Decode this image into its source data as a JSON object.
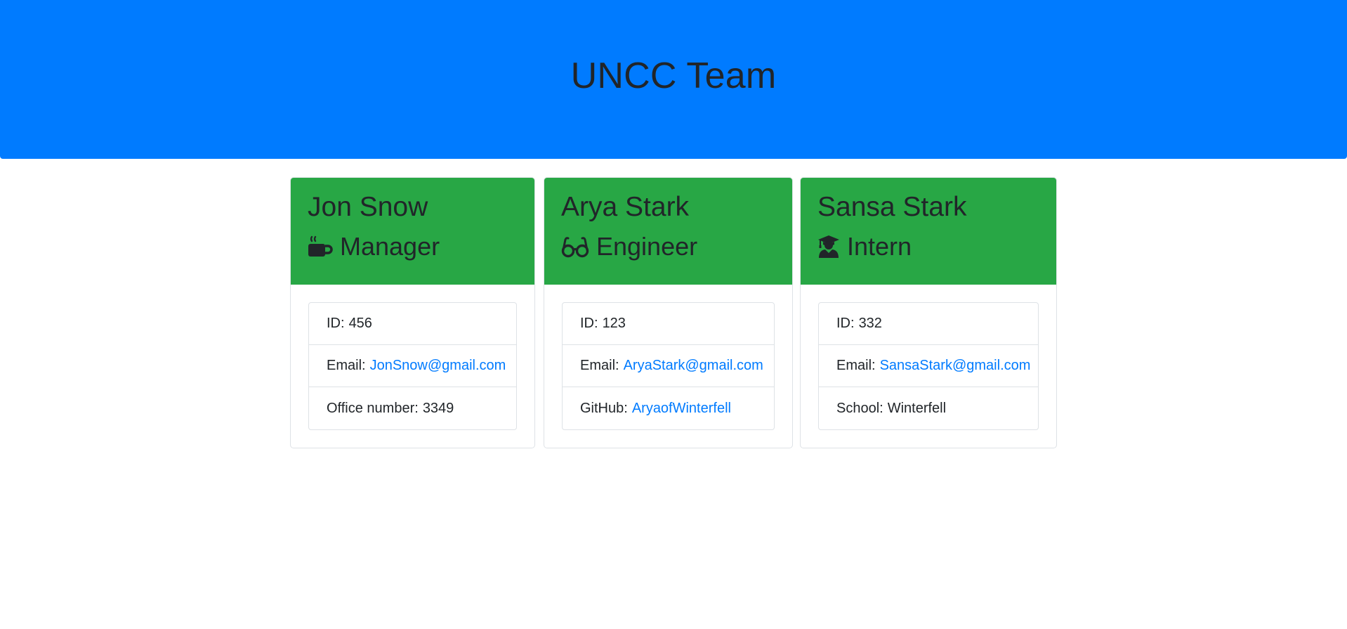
{
  "header": {
    "title": "UNCC Team"
  },
  "colors": {
    "header_bg": "#007bff",
    "card_header_bg": "#28a745",
    "link": "#007bff",
    "text": "#212529"
  },
  "cards": [
    {
      "name": "Jon Snow",
      "role": "Manager",
      "role_icon": "mug-hot-icon",
      "id_label": "ID:",
      "id": "456",
      "email_label": "Email:",
      "email": "JonSnow@gmail.com",
      "extra_label": "Office number:",
      "extra_value": "3349"
    },
    {
      "name": "Arya Stark",
      "role": "Engineer",
      "role_icon": "glasses-icon",
      "id_label": "ID:",
      "id": "123",
      "email_label": "Email:",
      "email": "AryaStark@gmail.com",
      "extra_label": "GitHub:",
      "extra_value": "AryaofWinterfell"
    },
    {
      "name": "Sansa Stark",
      "role": "Intern",
      "role_icon": "user-graduate-icon",
      "id_label": "ID:",
      "id": "332",
      "email_label": "Email:",
      "email": "SansaStark@gmail.com",
      "extra_label": "School:",
      "extra_value": "Winterfell"
    }
  ]
}
